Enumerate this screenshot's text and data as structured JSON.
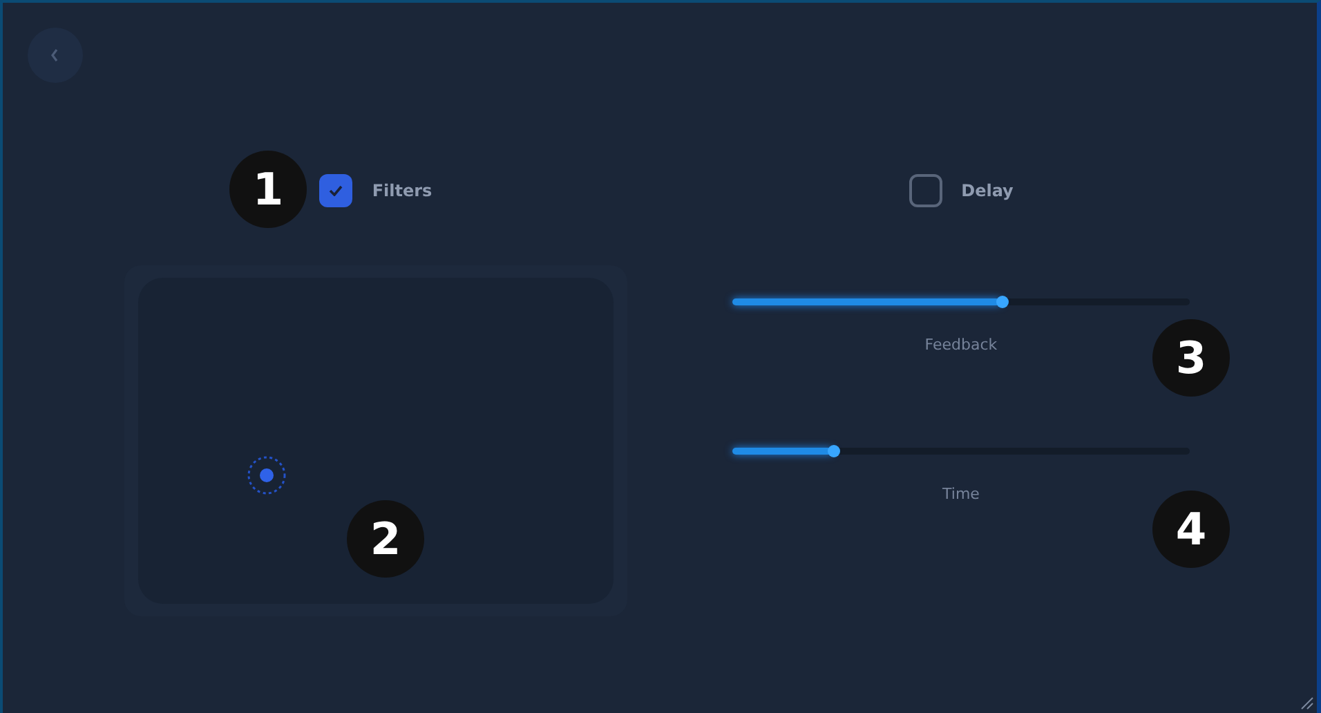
{
  "toggles": [
    {
      "label": "Filters",
      "checked": true
    },
    {
      "label": "Delay",
      "checked": false
    }
  ],
  "sliders": [
    {
      "label": "Feedback",
      "level": 0.59
    },
    {
      "label": "Time",
      "level": 0.22
    }
  ],
  "annotations": [
    {
      "label": "1"
    },
    {
      "label": "2"
    },
    {
      "label": "3"
    },
    {
      "label": "4"
    }
  ]
}
